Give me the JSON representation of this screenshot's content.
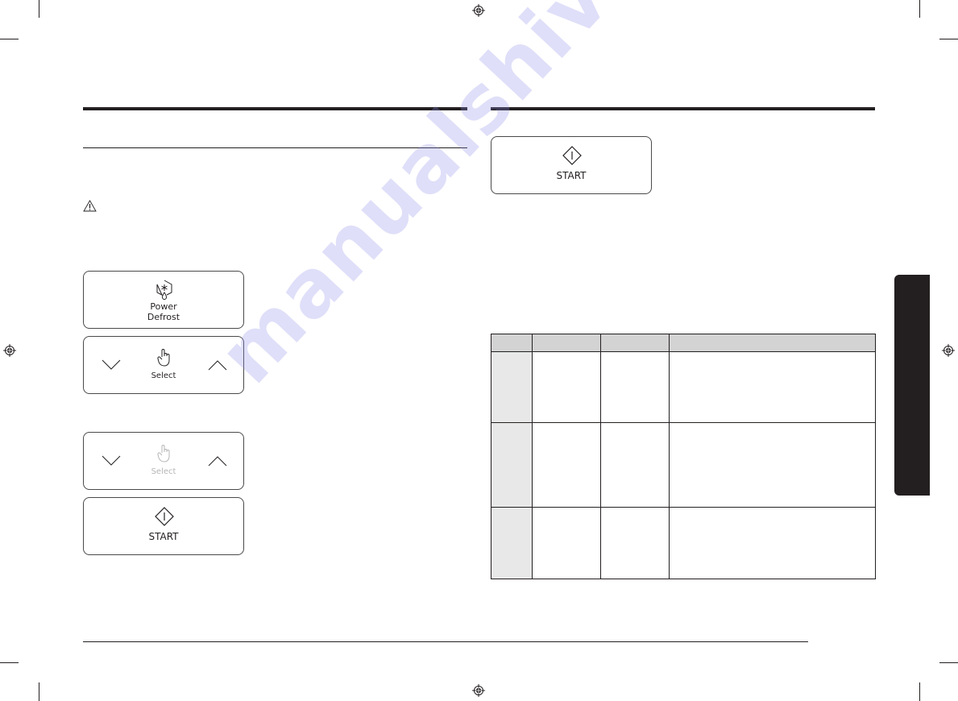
{
  "page": {
    "watermark": "manualshive.com"
  },
  "left_column": {
    "warning_icon": "warning-triangle-icon",
    "panels": [
      {
        "id": "power-defrost",
        "icon": "defrost-snowflake-drop-icon",
        "label_line1": "Power",
        "label_line2": "Defrost"
      },
      {
        "id": "select-active",
        "icon": "hand-pointer-icon",
        "left_icon": "chevron-down-icon",
        "right_icon": "chevron-up-icon",
        "label": "Select",
        "state": "active"
      },
      {
        "id": "select-dimmed",
        "icon": "hand-pointer-icon",
        "left_icon": "chevron-down-icon",
        "right_icon": "chevron-up-icon",
        "label": "Select",
        "state": "dimmed"
      },
      {
        "id": "start",
        "icon": "start-diamond-icon",
        "label": "START"
      }
    ]
  },
  "right_column": {
    "start_panel": {
      "icon": "start-diamond-icon",
      "label": "START"
    },
    "table": {
      "headers": [
        "",
        "",
        "",
        ""
      ],
      "rows": [
        [
          "",
          "",
          "",
          ""
        ],
        [
          "",
          "",
          "",
          ""
        ],
        [
          "",
          "",
          "",
          ""
        ]
      ]
    }
  },
  "colors": {
    "ink": "#231f20",
    "table_header_bg": "#d3d3d3",
    "table_first_col_bg": "#e8e8e8",
    "dimmed": "#b5b5b5",
    "watermark": "#8c8ceb"
  }
}
